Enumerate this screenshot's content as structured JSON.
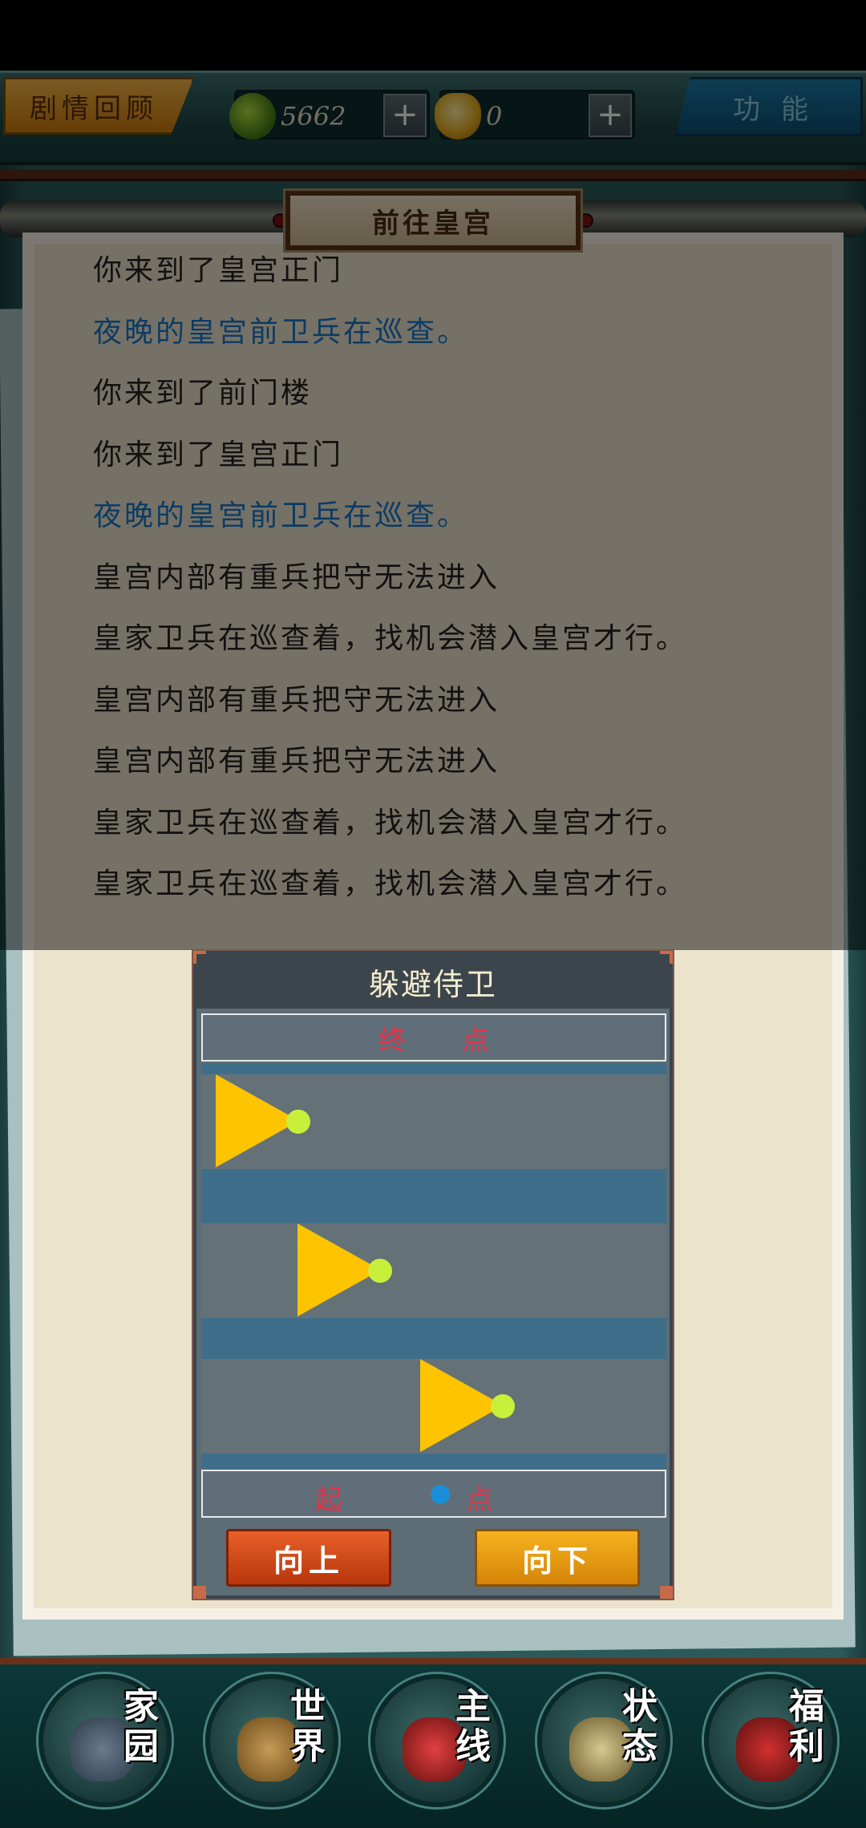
{
  "topbar": {
    "story_label": "剧情回顾",
    "coin_value": "5662",
    "gold_value": "0",
    "plus_label": "+",
    "function_label": "功能"
  },
  "panel": {
    "title": "前往皇宫",
    "log": [
      {
        "text": "你来到了皇宫正门",
        "style": "normal"
      },
      {
        "text": "夜晚的皇宫前卫兵在巡查。",
        "style": "blue"
      },
      {
        "text": "你来到了前门楼",
        "style": "normal"
      },
      {
        "text": "你来到了皇宫正门",
        "style": "normal"
      },
      {
        "text": "夜晚的皇宫前卫兵在巡查。",
        "style": "blue"
      },
      {
        "text": "皇宫内部有重兵把守无法进入",
        "style": "normal"
      },
      {
        "text": "皇家卫兵在巡查着，找机会潜入皇宫才行。",
        "style": "normal"
      },
      {
        "text": "皇宫内部有重兵把守无法进入",
        "style": "normal"
      },
      {
        "text": "皇宫内部有重兵把守无法进入",
        "style": "normal"
      },
      {
        "text": "皇家卫兵在巡查着，找机会潜入皇宫才行。",
        "style": "normal"
      },
      {
        "text": "皇家卫兵在巡查着，找机会潜入皇宫才行。",
        "style": "normal"
      }
    ]
  },
  "minigame": {
    "title": "躲避侍卫",
    "end_label": "终点",
    "start_label_left": "起",
    "start_label_right": "点",
    "up_button": "向上",
    "down_button": "向下",
    "guard_color": "#ffc400",
    "player_color": "#1a8fd8"
  },
  "nav": [
    {
      "label": "家园",
      "icon": "home-icon"
    },
    {
      "label": "世界",
      "icon": "world-map-icon"
    },
    {
      "label": "主线",
      "icon": "main-quest-icon"
    },
    {
      "label": "状态",
      "icon": "status-icon"
    },
    {
      "label": "福利",
      "icon": "welfare-icon"
    }
  ]
}
